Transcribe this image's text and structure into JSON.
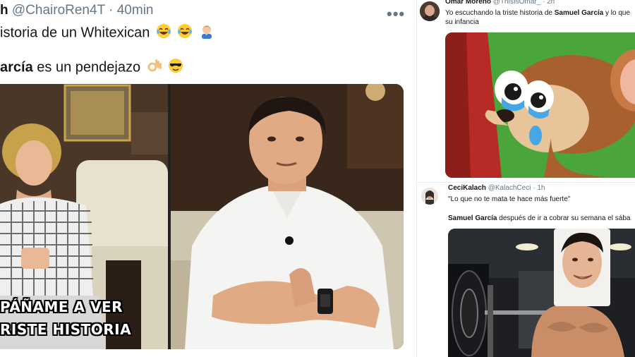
{
  "left_tweet": {
    "name": "h",
    "handle": "@ChairoRen4T",
    "separator": "·",
    "time": "40min",
    "more_icon": "more-dots-icon",
    "line1_text": "istoria de un Whitexican",
    "line1_emojis": [
      "tears-of-joy-emoji",
      "tears-of-joy-emoji",
      "man-facepalming-emoji"
    ],
    "line2_bold": "arcía",
    "line2_text": " es un pendejazo",
    "line2_emojis": [
      "ok-hand-emoji",
      "sunglasses-emoji"
    ],
    "media": {
      "caption_line1": "PÁÑAME A VER",
      "caption_line2": "RISTE HISTORIA"
    }
  },
  "right_column": {
    "tweet1": {
      "name": "Omar Moreno",
      "handle": "@ThisIsOmar_",
      "separator": "·",
      "time": "2h",
      "text_part1": "Yo escuchando la triste historia de ",
      "text_bold": "Samuel García",
      "text_part2": " y lo que",
      "text_line2": "su infancia"
    },
    "tweet2": {
      "name": "CeciKalach",
      "handle": "@KalachCeci",
      "separator": "·",
      "time": "1h",
      "quote": "\"Lo que no te mata te hace más fuerte\"",
      "text_bold": "Samuel García",
      "text_rest": " después de ir a cobrar su semana el sába"
    }
  },
  "colors": {
    "text_primary": "#14171a",
    "text_secondary": "#657786",
    "border": "#e6ecf0"
  }
}
